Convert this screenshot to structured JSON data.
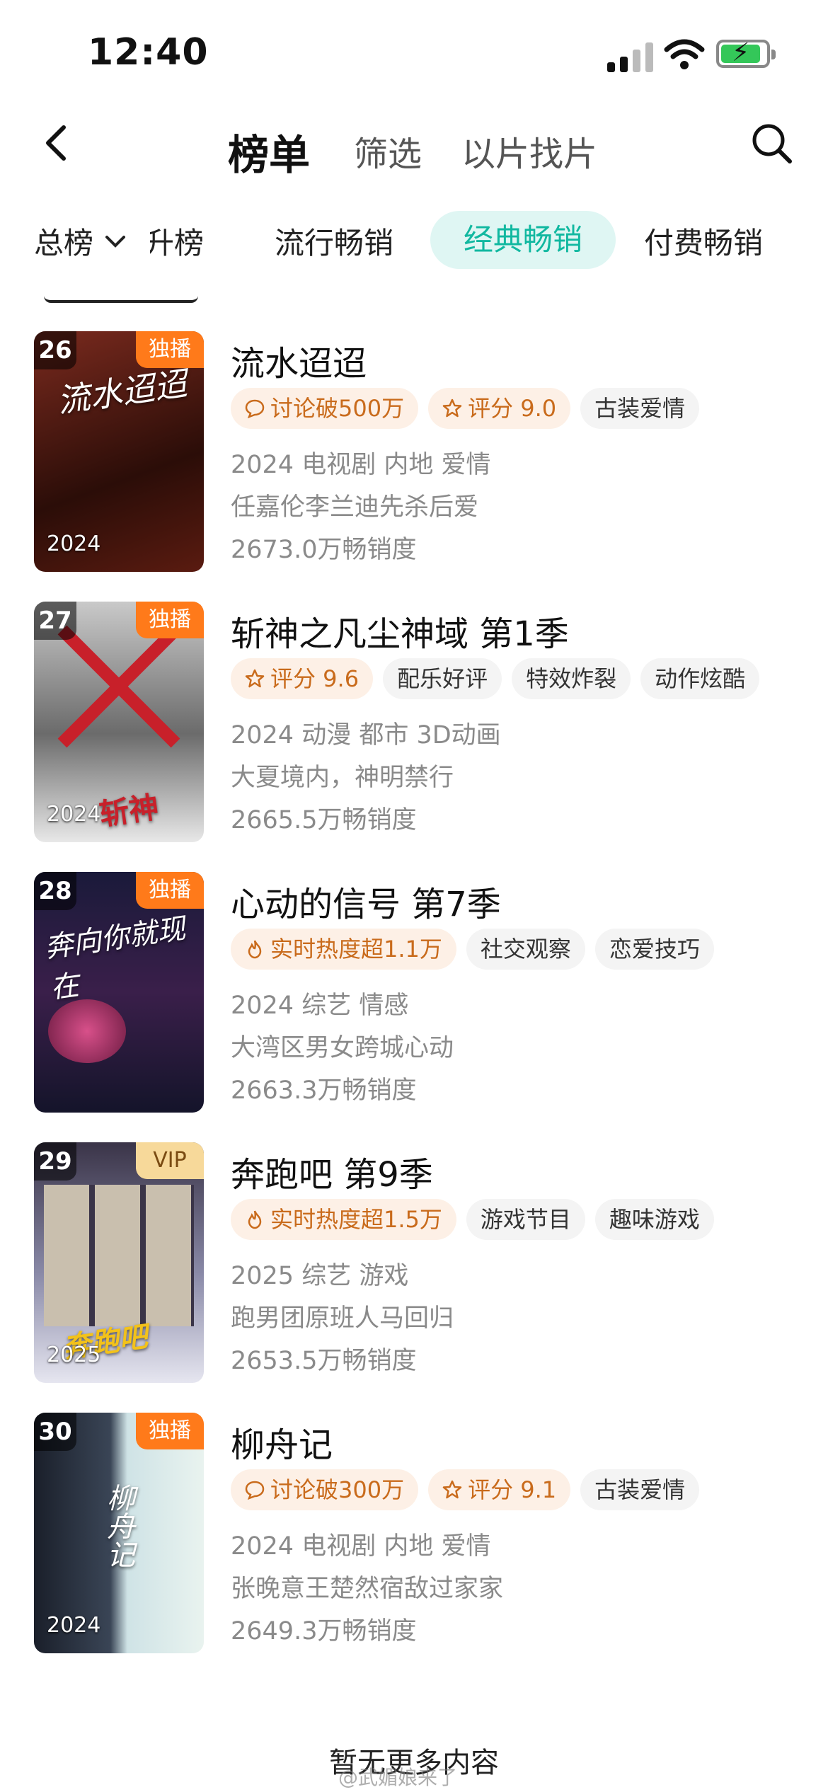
{
  "status": {
    "time": "12:40"
  },
  "nav": {
    "title": "榜单",
    "tabs": [
      "筛选",
      "以片找片"
    ]
  },
  "categories": {
    "dropdown": "总榜",
    "items": [
      "升榜",
      "流行畅销",
      "经典畅销",
      "付费畅销"
    ],
    "active": "经典畅销"
  },
  "items": [
    {
      "rank": "26",
      "badge": "独播",
      "poster_year": "2024",
      "poster_text": "流水迢迢",
      "title": "流水迢迢",
      "tags": [
        {
          "text": "讨论破500万",
          "icon": "chat-icon"
        },
        {
          "text": "评分 9.0",
          "icon": "star-icon"
        },
        {
          "text": "古装爱情"
        }
      ],
      "line1": "2024 电视剧 内地 爱情",
      "line2": "任嘉伦李兰迪先杀后爱",
      "sales": "2673.0万畅销度"
    },
    {
      "rank": "27",
      "badge": "独播",
      "poster_year": "2024",
      "poster_text": "斩神",
      "title": "斩神之凡尘神域 第1季",
      "tags": [
        {
          "text": "评分 9.6",
          "icon": "star-icon"
        },
        {
          "text": "配乐好评"
        },
        {
          "text": "特效炸裂"
        },
        {
          "text": "动作炫酷"
        }
      ],
      "line1": "2024 动漫 都市 3D动画",
      "line2": "大夏境内，神明禁行",
      "sales": "2665.5万畅销度"
    },
    {
      "rank": "28",
      "badge": "独播",
      "poster_year": "",
      "poster_text": "奔向你就现在",
      "title": "心动的信号 第7季",
      "tags": [
        {
          "text": "实时热度超1.1万",
          "icon": "flame-icon"
        },
        {
          "text": "社交观察"
        },
        {
          "text": "恋爱技巧"
        }
      ],
      "line1": "2024 综艺 情感",
      "line2": "大湾区男女跨城心动",
      "sales": "2663.3万畅销度"
    },
    {
      "rank": "29",
      "badge": "VIP",
      "poster_year": "2025",
      "poster_text": "奔跑吧",
      "title": "奔跑吧 第9季",
      "tags": [
        {
          "text": "实时热度超1.5万",
          "icon": "flame-icon"
        },
        {
          "text": "游戏节目"
        },
        {
          "text": "趣味游戏"
        }
      ],
      "line1": "2025 综艺 游戏",
      "line2": "跑男团原班人马回归",
      "sales": "2653.5万畅销度"
    },
    {
      "rank": "30",
      "badge": "独播",
      "poster_year": "2024",
      "poster_text": "柳舟记",
      "title": "柳舟记",
      "tags": [
        {
          "text": "讨论破300万",
          "icon": "chat-icon"
        },
        {
          "text": "评分 9.1",
          "icon": "star-icon"
        },
        {
          "text": "古装爱情"
        }
      ],
      "line1": "2024 电视剧 内地 爱情",
      "line2": "张晚意王楚然宿敌过家家",
      "sales": "2649.3万畅销度"
    }
  ],
  "footer": {
    "end_text": "暂无更多内容",
    "watermark": "@武媚娘来了"
  },
  "colors": {
    "accent": "#11b8a0",
    "badge": "#ff7a1a",
    "hot_tag_text": "#c96b1c"
  }
}
